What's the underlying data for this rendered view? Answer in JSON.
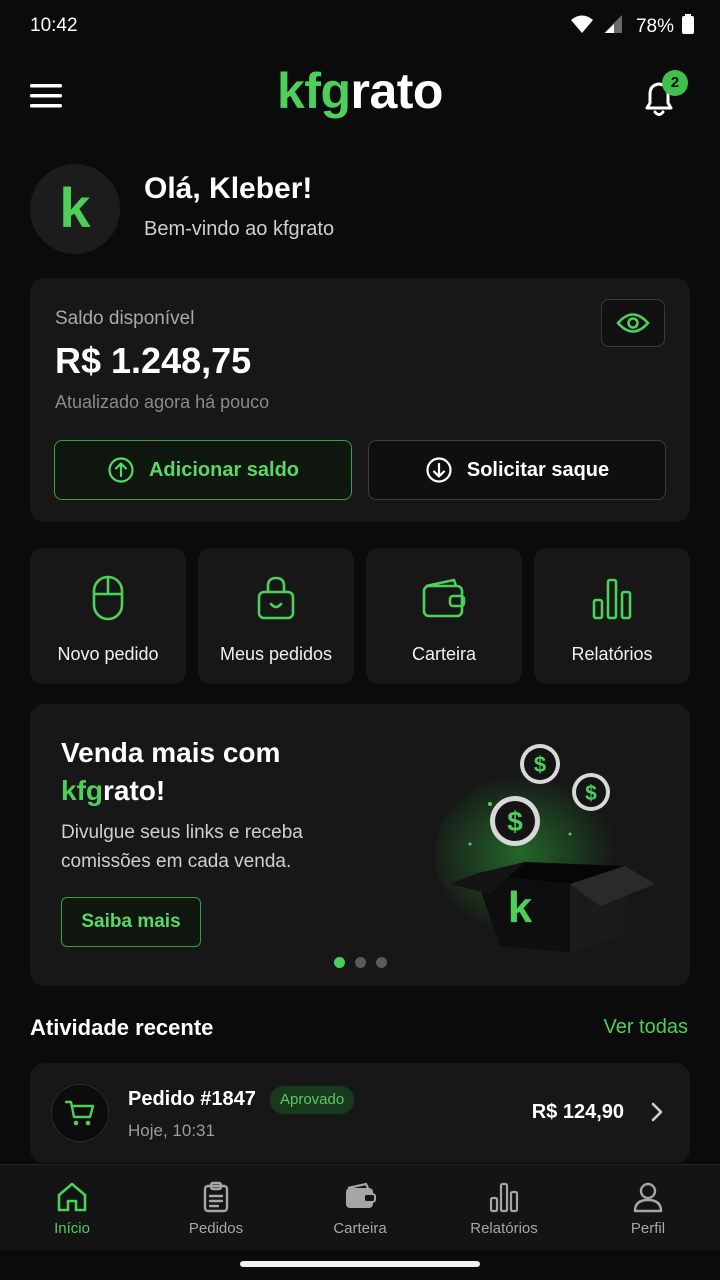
{
  "status_bar": {
    "time": "10:42",
    "battery": "78%"
  },
  "header": {
    "logo_accent": "kfg",
    "logo_rest": "rato",
    "notification_count": "2"
  },
  "greeting": {
    "avatar_letter": "k",
    "title": "Olá, Kleber!",
    "subtitle": "Bem-vindo ao kfgrato"
  },
  "balance": {
    "label": "Saldo disponível",
    "value": "R$ 1.248,75",
    "updated": "Atualizado agora há pouco",
    "add_label": "Adicionar saldo",
    "withdraw_label": "Solicitar saque"
  },
  "shortcuts": [
    {
      "label": "Novo pedido",
      "icon": "mouse-icon"
    },
    {
      "label": "Meus pedidos",
      "icon": "bag-icon"
    },
    {
      "label": "Carteira",
      "icon": "wallet-icon"
    },
    {
      "label": "Relatórios",
      "icon": "bar-chart-icon"
    }
  ],
  "promo": {
    "title_line1": "Venda mais com",
    "title_accent": "kfg",
    "title_rest": "rato!",
    "description": "Divulgue seus links e receba comissões em cada venda.",
    "button_label": "Saiba mais",
    "box_letter": "k",
    "coin_symbol": "$",
    "carousel_active_index": 0
  },
  "activity": {
    "title": "Atividade recente",
    "see_all": "Ver todas",
    "items": [
      {
        "title": "Pedido #1847",
        "status": "Aprovado",
        "time": "Hoje, 10:31",
        "amount": "R$ 124,90"
      }
    ]
  },
  "nav": {
    "items": [
      {
        "label": "Início",
        "icon": "home-icon",
        "active": true
      },
      {
        "label": "Pedidos",
        "icon": "clipboard-icon",
        "active": false
      },
      {
        "label": "Carteira",
        "icon": "wallet-icon",
        "active": false
      },
      {
        "label": "Relatórios",
        "icon": "bar-chart-icon",
        "active": false
      },
      {
        "label": "Perfil",
        "icon": "user-icon",
        "active": false
      }
    ]
  },
  "colors": {
    "accent": "#4cd05a",
    "background": "#0b0b0b",
    "card": "#171717"
  }
}
